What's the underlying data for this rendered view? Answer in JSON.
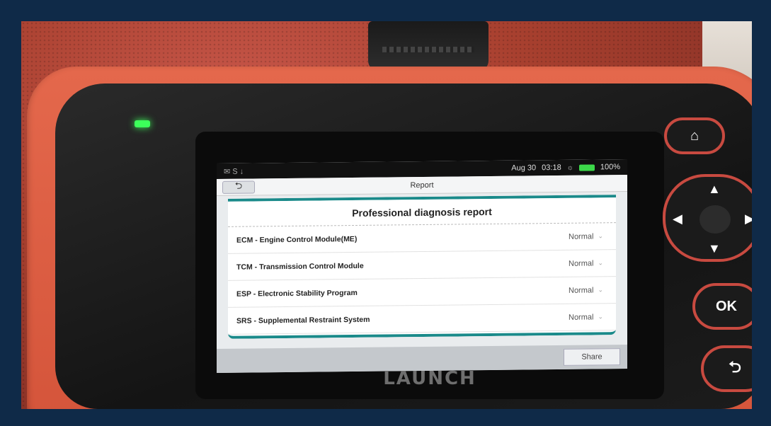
{
  "status_bar": {
    "left_icons": "✉ S ↓",
    "date": "Aug 30",
    "time": "03:18",
    "battery": "100%"
  },
  "header": {
    "back_icon": "back-arrow-icon",
    "title": "Report"
  },
  "report": {
    "heading": "Professional diagnosis report",
    "rows": [
      {
        "label": "ECM - Engine Control Module(ME)",
        "status": "Normal"
      },
      {
        "label": "TCM - Transmission Control Module",
        "status": "Normal"
      },
      {
        "label": "ESP - Electronic Stability Program",
        "status": "Normal"
      },
      {
        "label": "SRS - Supplemental Restraint System",
        "status": "Normal"
      }
    ]
  },
  "footer": {
    "share_label": "Share"
  },
  "device": {
    "brand": "LAUNCH",
    "ok_label": "OK",
    "home_icon": "home-icon",
    "back_icon": "return-icon"
  },
  "colors": {
    "accent": "#1a8a8a",
    "shell": "#d4543a",
    "led": "#3cff5a"
  }
}
